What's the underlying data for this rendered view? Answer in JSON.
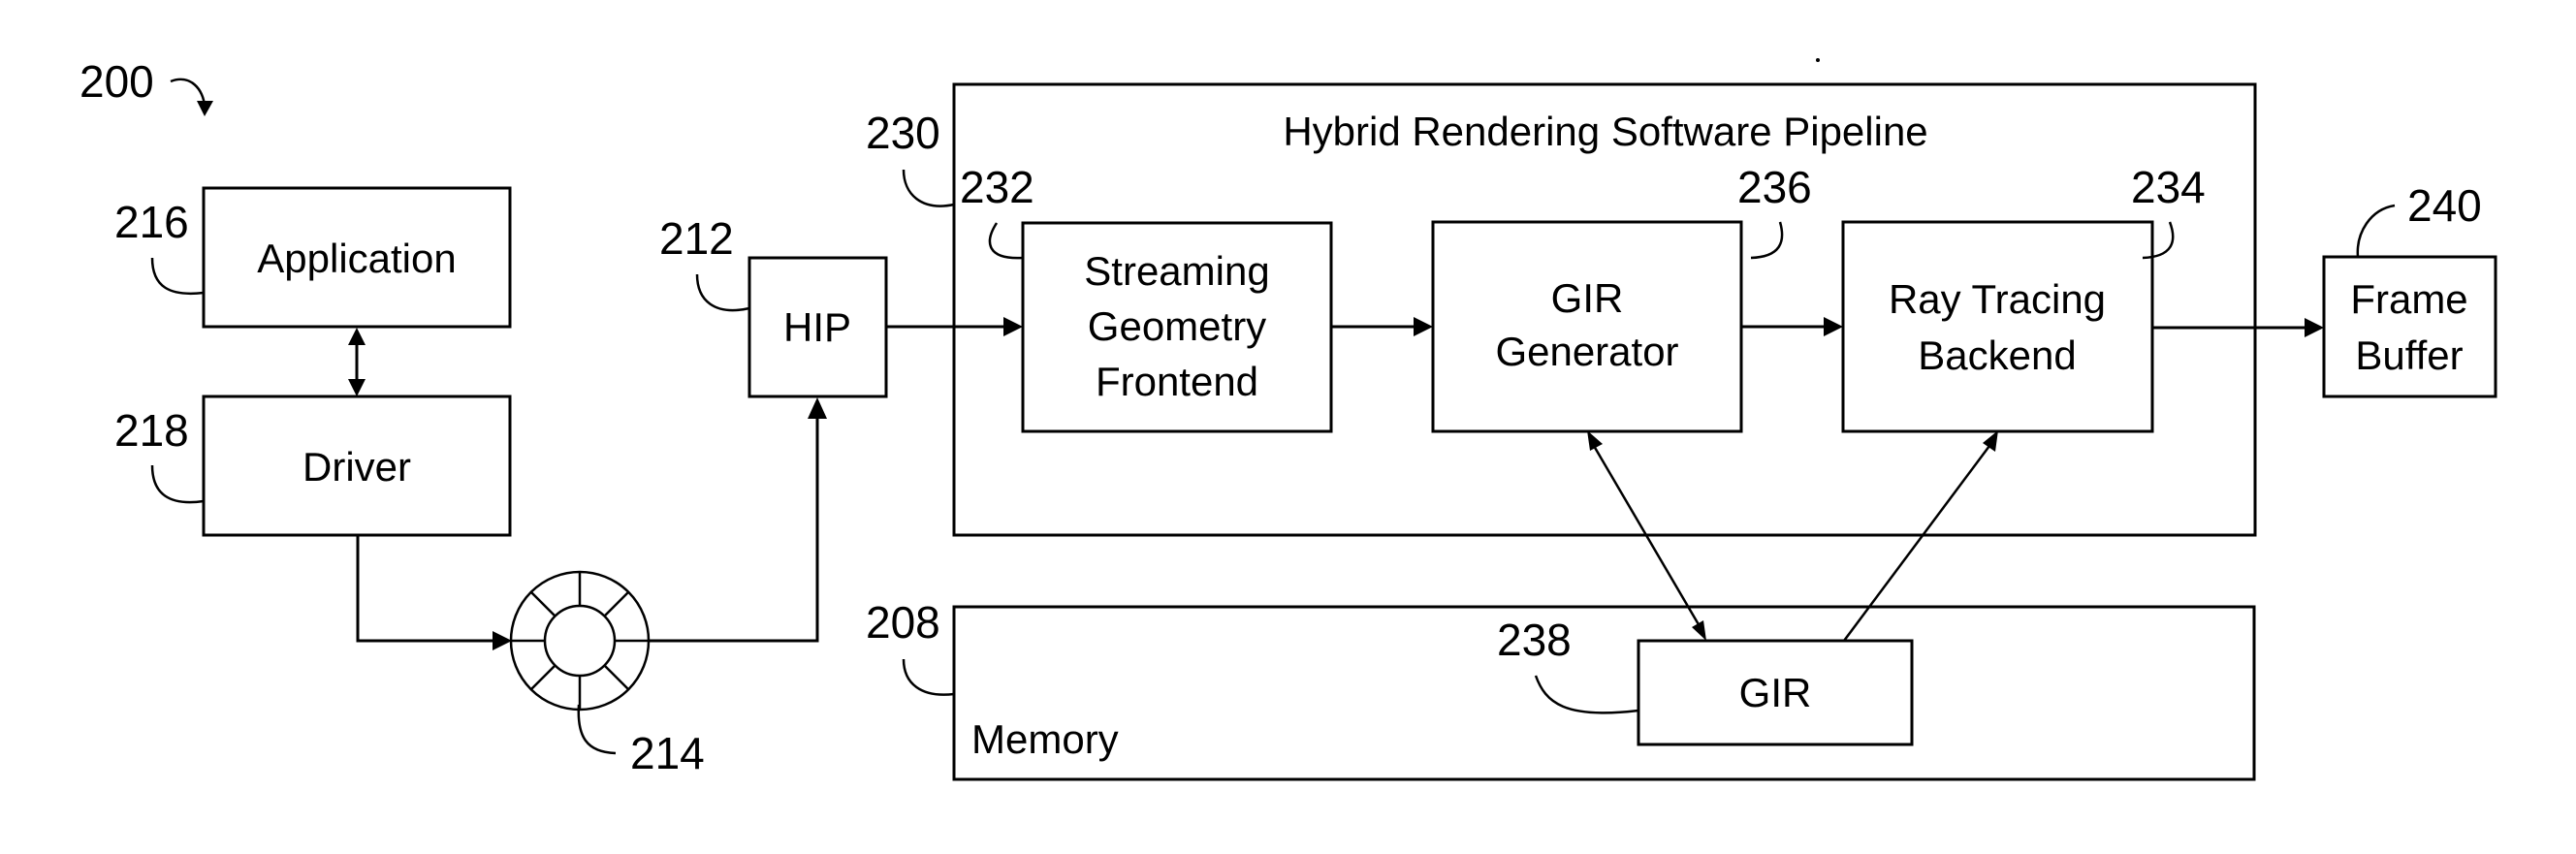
{
  "figure": {
    "id_label": "200",
    "reference_numerals": {
      "application": "216",
      "driver": "218",
      "hip": "212",
      "ring_buffer": "214",
      "pipeline": "230",
      "streaming_geometry_frontend": "232",
      "gir_generator": "236",
      "ray_tracing_backend": "234",
      "frame_buffer": "240",
      "memory": "208",
      "gir": "238"
    },
    "blocks": {
      "application": [
        "Application"
      ],
      "driver": [
        "Driver"
      ],
      "hip": [
        "HIP"
      ],
      "streaming_geometry_frontend": [
        "Streaming",
        "Geometry",
        "Frontend"
      ],
      "gir_generator": [
        "GIR",
        "Generator"
      ],
      "ray_tracing_backend": [
        "Ray Tracing",
        "Backend"
      ],
      "frame_buffer": [
        "Frame",
        "Buffer"
      ],
      "gir": [
        "GIR"
      ]
    },
    "containers": {
      "pipeline_title": "Hybrid Rendering Software Pipeline",
      "memory_title": "Memory"
    },
    "connections": [
      {
        "from": "application",
        "to": "driver",
        "type": "bidirectional"
      },
      {
        "from": "driver",
        "to": "ring_buffer",
        "type": "arrow"
      },
      {
        "from": "ring_buffer",
        "to": "hip",
        "type": "arrow"
      },
      {
        "from": "hip",
        "to": "streaming_geometry_frontend",
        "type": "arrow"
      },
      {
        "from": "streaming_geometry_frontend",
        "to": "gir_generator",
        "type": "arrow"
      },
      {
        "from": "gir_generator",
        "to": "ray_tracing_backend",
        "type": "arrow"
      },
      {
        "from": "ray_tracing_backend",
        "to": "frame_buffer",
        "type": "arrow"
      },
      {
        "from": "gir_generator",
        "to": "gir",
        "type": "bidirectional"
      },
      {
        "from": "gir",
        "to": "ray_tracing_backend",
        "type": "arrow"
      }
    ]
  }
}
